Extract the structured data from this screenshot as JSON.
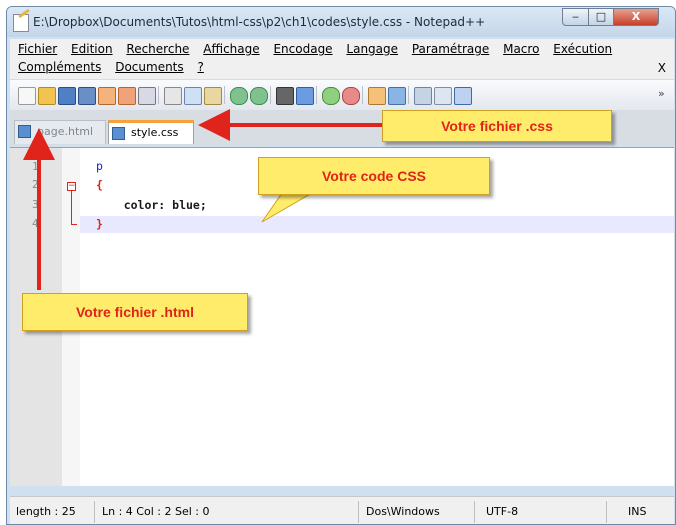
{
  "window": {
    "title": "E:\\Dropbox\\Documents\\Tutos\\html-css\\p2\\ch1\\codes\\style.css - Notepad++",
    "buttons": {
      "minimize": "‒",
      "maximize": "□",
      "close": "X"
    }
  },
  "menu": {
    "row1": [
      "Fichier",
      "Edition",
      "Recherche",
      "Affichage",
      "Encodage",
      "Langage",
      "Paramétrage",
      "Macro",
      "Exécution"
    ],
    "row2": [
      "Compléments",
      "Documents",
      "?"
    ],
    "close_doc": "X"
  },
  "toolbar": {
    "icons": [
      "new-file-icon",
      "open-file-icon",
      "save-icon",
      "save-all-icon",
      "close-icon",
      "close-all-icon",
      "print-icon",
      "cut-icon",
      "copy-icon",
      "paste-icon",
      "undo-icon",
      "redo-icon",
      "find-icon",
      "replace-icon",
      "zoom-in-icon",
      "zoom-out-icon",
      "sync-v-icon",
      "sync-h-icon",
      "wrap-icon",
      "show-all-chars-icon",
      "indent-guide-icon"
    ],
    "overflow": "»"
  },
  "tabs": [
    {
      "label": "page.html",
      "active": false
    },
    {
      "label": "style.css",
      "active": true
    }
  ],
  "editor": {
    "line_numbers": [
      "1",
      "2",
      "3",
      "4"
    ],
    "lines": [
      "p",
      "{",
      "    color: blue;",
      "}"
    ]
  },
  "status": {
    "length": "length : 25",
    "position": "Ln : 4    Col : 2    Sel : 0",
    "eol": "Dos\\Windows",
    "encoding": "UTF-8",
    "mode": "INS"
  },
  "annotations": {
    "css_file": "Votre fichier .css",
    "css_code": "Votre code CSS",
    "html_file": "Votre fichier .html"
  },
  "colors": {
    "callout_bg": "#ffec6a",
    "callout_text": "#e0241b",
    "arrow": "#e0241b",
    "tab_accent": "#f5a23a"
  }
}
